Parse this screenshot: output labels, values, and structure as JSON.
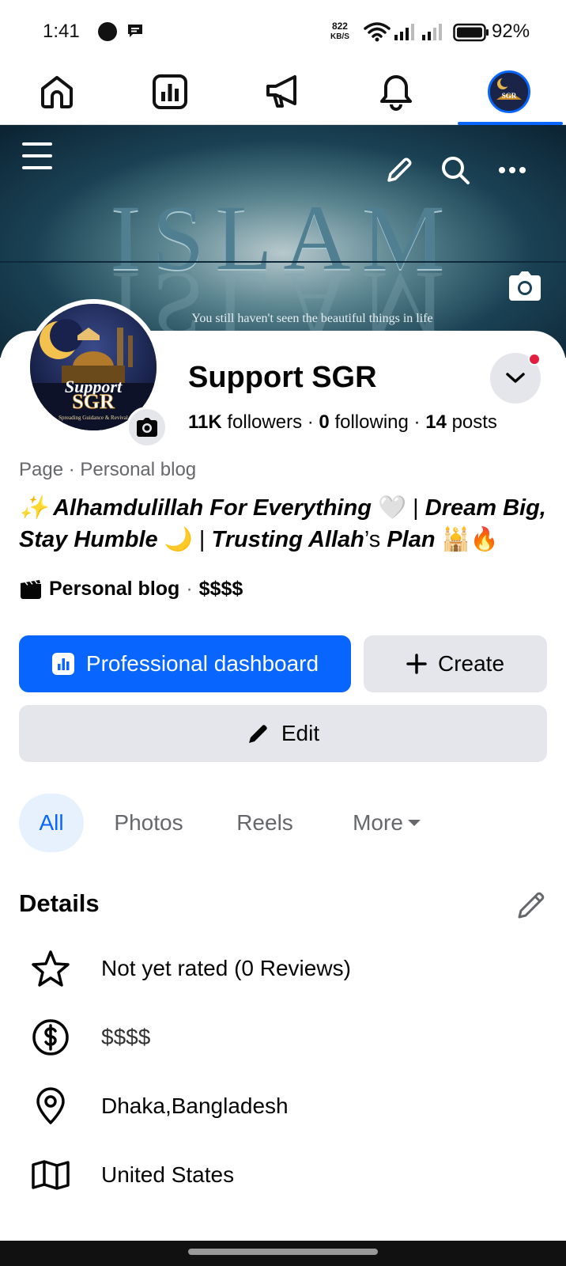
{
  "status_bar": {
    "time": "1:41",
    "net_speed": "822",
    "net_unit": "KB/S",
    "battery": "92%"
  },
  "nav": {
    "items": [
      "home-icon",
      "dashboard-icon",
      "megaphone-icon",
      "bell-icon",
      "profile-avatar"
    ],
    "active": "profile-avatar"
  },
  "cover": {
    "word": "ISLAM",
    "tagline": "You still haven't seen the beautiful things in life"
  },
  "profile": {
    "name": "Support SGR",
    "followers_count": "11K",
    "followers_label": "followers",
    "following_count": "0",
    "following_label": "following",
    "posts_count": "14",
    "posts_label": "posts",
    "avatar_text_line1": "Support",
    "avatar_text_line2": "SGR",
    "avatar_text_line3": "Spreading Guidance & Revival"
  },
  "category": "Page · Personal blog",
  "bio": {
    "line1_a": "✨ ",
    "line1_b": "Alhamdulillah For Everything",
    "line1_c": " 🤍 | ",
    "line1_d": "Dream Big,",
    "line2_a": "Stay Humble",
    "line2_b": " 🌙 | ",
    "line2_c": "Trusting Allah",
    "line2_d": "’s ",
    "line2_e": "Plan",
    "line2_f": " 🕌🔥"
  },
  "info_line": {
    "category": "Personal blog",
    "separator": "·",
    "price": "$$$$"
  },
  "buttons": {
    "dashboard": "Professional dashboard",
    "create": "Create",
    "edit": "Edit"
  },
  "tabs": [
    "All",
    "Photos",
    "Reels",
    "More"
  ],
  "details": {
    "title": "Details",
    "rows": [
      {
        "icon": "star-icon",
        "text": "Not yet rated (0 Reviews)"
      },
      {
        "icon": "dollar-icon",
        "text": "$$$$"
      },
      {
        "icon": "location-pin-icon",
        "text": "Dhaka,Bangladesh"
      },
      {
        "icon": "map-icon",
        "text": "United States"
      }
    ]
  },
  "colors": {
    "accent": "#0866ff",
    "button_gray": "#e4e6eb",
    "secondary_text": "#65676b",
    "notification_dot": "#e41e3f"
  }
}
